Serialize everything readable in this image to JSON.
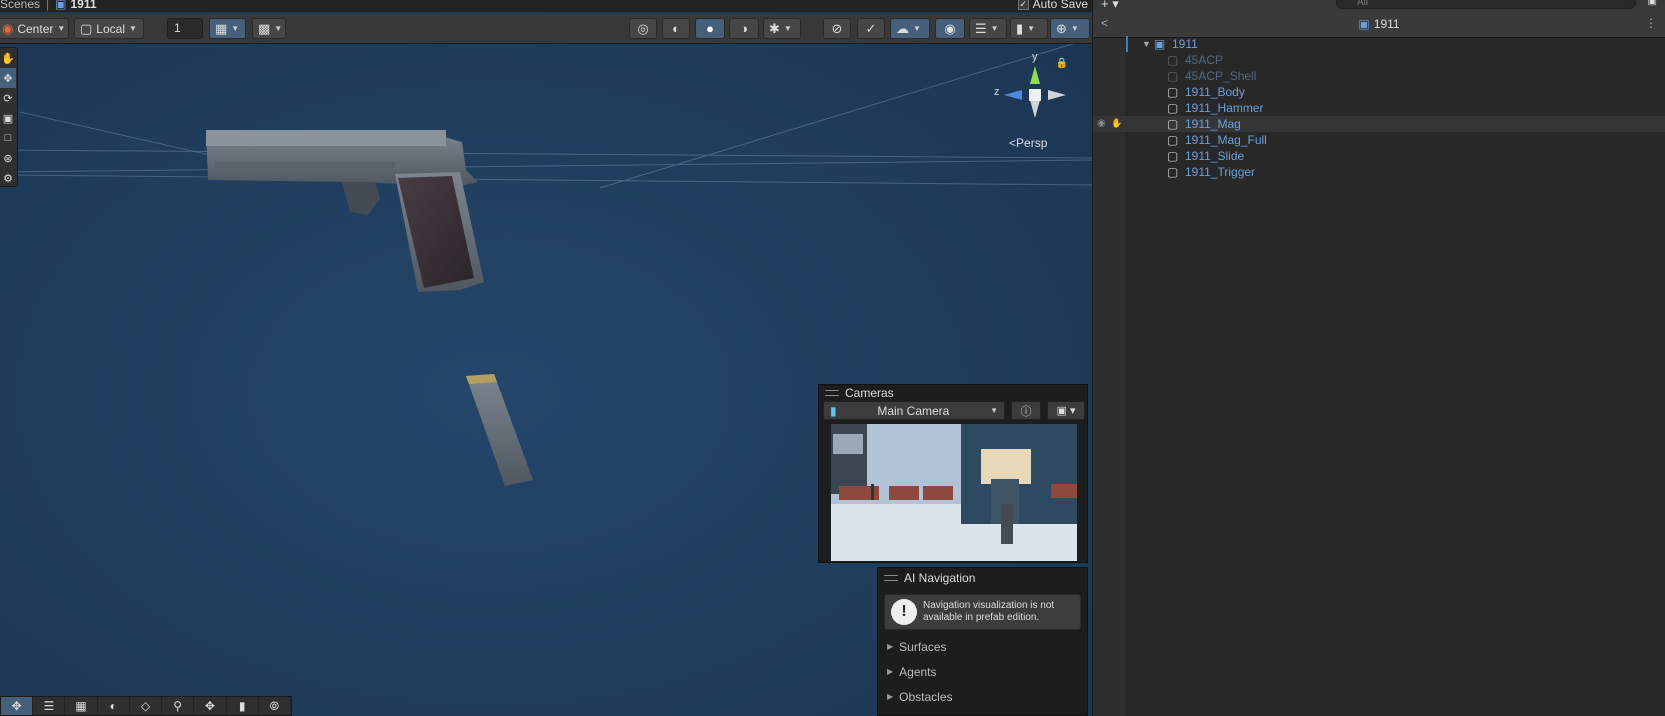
{
  "breadcrumb": {
    "scenes_label": "Scenes",
    "separator": "|",
    "prefab_name": "1911"
  },
  "autosave": {
    "label": "Auto Save",
    "checked": true
  },
  "toolbar": {
    "pivot_label": "Center",
    "space_label": "Local",
    "grid_value": "1"
  },
  "gizmo": {
    "y_label": "y",
    "z_label": "z",
    "persp_label": "Persp"
  },
  "cameras": {
    "title": "Cameras",
    "selected_camera": "Main Camera"
  },
  "ai_navigation": {
    "title": "AI Navigation",
    "warning": "Navigation visualization is not available in prefab edition.",
    "sections": [
      "Surfaces",
      "Agents",
      "Obstacles"
    ]
  },
  "hierarchy": {
    "search_placeholder": "All",
    "header_title": "1911",
    "root": "1911",
    "items": [
      {
        "label": "45ACP",
        "disabled": true
      },
      {
        "label": "45ACP_Shell",
        "disabled": true
      },
      {
        "label": "1911_Body",
        "disabled": false
      },
      {
        "label": "1911_Hammer",
        "disabled": false
      },
      {
        "label": "1911_Mag",
        "disabled": false,
        "selected": true
      },
      {
        "label": "1911_Mag_Full",
        "disabled": false
      },
      {
        "label": "1911_Slide",
        "disabled": false
      },
      {
        "label": "1911_Trigger",
        "disabled": false
      }
    ]
  },
  "colors": {
    "scene_background": "#1f3b5a",
    "selection_blue": "#46607c",
    "prefab_text": "#6a9fe0"
  }
}
